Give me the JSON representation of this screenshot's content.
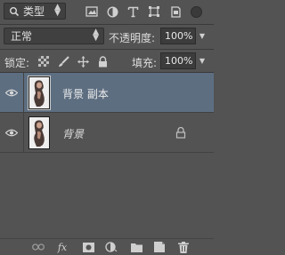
{
  "filter": {
    "label": "类型"
  },
  "blend_mode": {
    "value": "正常"
  },
  "opacity": {
    "label": "不透明度:",
    "value": "100%"
  },
  "lock": {
    "label": "锁定:"
  },
  "fill": {
    "label": "填充:",
    "value": "100%"
  },
  "layers": [
    {
      "name": "背景 副本",
      "selected": true,
      "visible": true,
      "locked": false
    },
    {
      "name": "背景",
      "selected": false,
      "visible": true,
      "locked": true
    }
  ],
  "colors": {
    "panel": "#535353",
    "selected": "#5d6e81",
    "field": "#404040"
  },
  "icons": {
    "filter_row": [
      "image-filter-icon",
      "adjustment-filter-icon",
      "type-filter-icon",
      "shape-filter-icon",
      "smart-object-filter-icon"
    ],
    "lock_row": [
      "lock-transparent-pixels-icon",
      "lock-image-pixels-icon",
      "lock-position-icon",
      "lock-all-icon"
    ],
    "toolbar": [
      "link-layers-icon",
      "fx-icon",
      "add-mask-icon",
      "adjustment-layer-icon",
      "new-group-icon",
      "new-layer-icon",
      "delete-layer-icon"
    ]
  },
  "toolbar": {
    "fx_label": "fx"
  }
}
